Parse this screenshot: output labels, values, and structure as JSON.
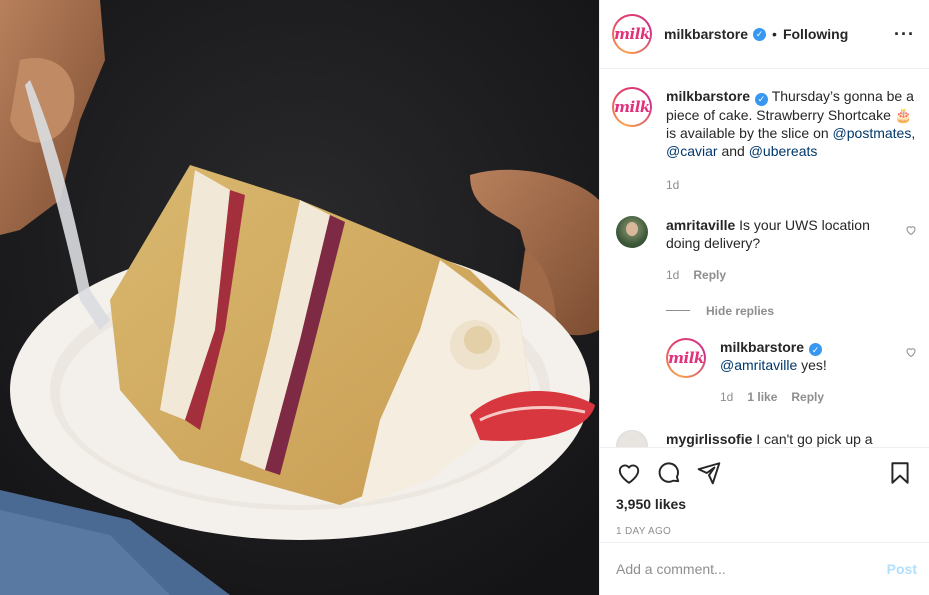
{
  "post": {
    "username": "milkbarstore",
    "verified_icon": "verified-check-icon",
    "separator": "•",
    "follow_status": "Following",
    "more_icon": "more-options-icon",
    "avatar_logo": "milk"
  },
  "caption": {
    "username": "milkbarstore",
    "text_part1": "Thursday’s gonna be a piece of cake. Strawberry Shortcake ",
    "emoji": "🎂",
    "text_part2": " is available by the slice on ",
    "mention1": "@postmates",
    "sep": ", ",
    "mention2": "@caviar",
    "and": " and ",
    "mention3": "@ubereats",
    "time": "1d"
  },
  "comments": [
    {
      "username": "amritaville",
      "text": "Is your UWS location doing delivery?",
      "time": "1d",
      "reply_label": "Reply"
    }
  ],
  "hide_replies_label": "Hide replies",
  "reply": {
    "username": "milkbarstore",
    "mention": "@amritaville",
    "text": " yes!",
    "time": "1d",
    "likes": "1 like",
    "reply_label": "Reply"
  },
  "partial_comment": {
    "username": "mygirlissofie",
    "text": "I can't go pick up a"
  },
  "actions": {
    "like_icon": "heart-icon",
    "comment_icon": "comment-icon",
    "share_icon": "paper-plane-icon",
    "save_icon": "bookmark-icon",
    "likes": "3,950 likes",
    "time": "1 DAY AGO"
  },
  "add_comment": {
    "placeholder": "Add a comment...",
    "post_label": "Post"
  },
  "colors": {
    "brand_pink": "#e3307a",
    "link": "#00376b",
    "verified": "#3897f0",
    "muted": "#8e8e8e",
    "post_disabled": "#b2dffc"
  }
}
